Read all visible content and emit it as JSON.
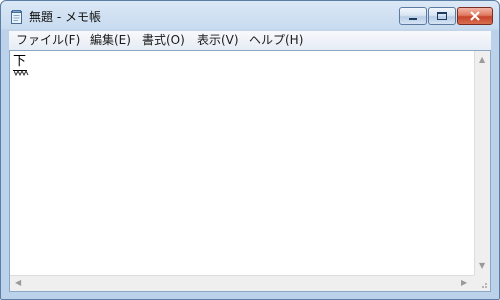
{
  "window": {
    "title": "無題 - メモ帳",
    "icon": "notepad-icon",
    "controls": {
      "minimize_icon": "minimize-icon",
      "maximize_icon": "maximize-icon",
      "close_icon": "close-icon"
    }
  },
  "menubar": {
    "items": [
      {
        "label": "ファイル(F)"
      },
      {
        "label": "編集(E)"
      },
      {
        "label": "書式(O)"
      },
      {
        "label": "表示(V)"
      },
      {
        "label": "ヘルプ(H)"
      }
    ]
  },
  "editor": {
    "content": "下"
  },
  "colors": {
    "frame": "#bcd2ea",
    "close_button": "#c7432c",
    "ime_underline": "#000000"
  }
}
